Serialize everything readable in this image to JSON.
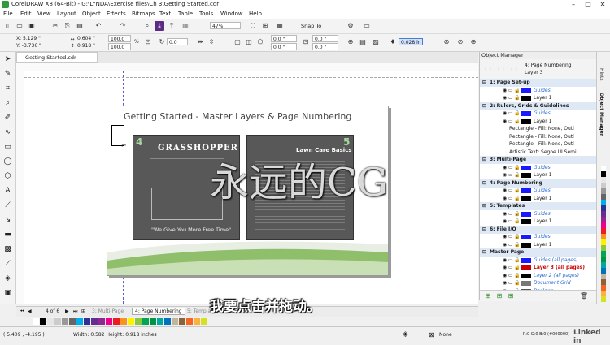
{
  "window": {
    "title": "CorelDRAW X8 (64-Bit) - G:\\LYNDA\\Exercise files\\Ch 3\\Getting Started.cdr"
  },
  "menu": [
    "File",
    "Edit",
    "View",
    "Layout",
    "Object",
    "Effects",
    "Bitmaps",
    "Text",
    "Table",
    "Tools",
    "Window",
    "Help"
  ],
  "toolbar": {
    "zoom": "47%",
    "snap_to": "Snap To"
  },
  "property_bar": {
    "x": "X: 5.129 \"",
    "y": "Y: -3.736 \"",
    "width": "0.604 \"",
    "height": "0.918 \"",
    "scale_w": "100.0",
    "scale_h": "100.0",
    "pct": "%",
    "angle": "0.0",
    "pos_x": "0.0 \"",
    "pos_y": "0.0 \"",
    "pos_x2": "0.0 \"",
    "pos_y2": "0.0 \"",
    "outline": "0.028 in"
  },
  "document": {
    "tab_label": "Getting Started.cdr",
    "page_title": "Getting Started - Master Layers & Page Numbering",
    "panel_left": {
      "number": "4",
      "heading": "GRASSHOPPER",
      "tagline": "\"We Give You More Free Time\""
    },
    "panel_right": {
      "number": "5",
      "heading": "Lawn Care Basics"
    }
  },
  "object_manager": {
    "title": "Object Manager",
    "current": "4: Page Numbering",
    "current_layer": "Layer 3",
    "rows": [
      {
        "label": "1: Page Set-up",
        "kind": "page"
      },
      {
        "label": "Guides",
        "kind": "guides",
        "swatch": "#1a1aff"
      },
      {
        "label": "Layer 1",
        "kind": "layer",
        "swatch": "#000000"
      },
      {
        "label": "2: Rulers, Grids & Guidelines",
        "kind": "page"
      },
      {
        "label": "Guides",
        "kind": "guides",
        "swatch": "#1a1aff"
      },
      {
        "label": "Layer 1",
        "kind": "layer",
        "swatch": "#000000"
      },
      {
        "label": "Rectangle - Fill: None, Outl",
        "kind": "object"
      },
      {
        "label": "Rectangle - Fill: None, Outl",
        "kind": "object"
      },
      {
        "label": "Rectangle - Fill: None, Outl",
        "kind": "object"
      },
      {
        "label": "Artistic Text: Segoe UI Semi",
        "kind": "object"
      },
      {
        "label": "3: Multi-Page",
        "kind": "page"
      },
      {
        "label": "Guides",
        "kind": "guides",
        "swatch": "#1a1aff"
      },
      {
        "label": "Layer 1",
        "kind": "layer",
        "swatch": "#000000"
      },
      {
        "label": "4: Page Numbering",
        "kind": "page"
      },
      {
        "label": "Guides",
        "kind": "guides",
        "swatch": "#1a1aff"
      },
      {
        "label": "Layer 1",
        "kind": "layer",
        "swatch": "#000000"
      },
      {
        "label": "5: Templates",
        "kind": "page"
      },
      {
        "label": "Guides",
        "kind": "guides",
        "swatch": "#1a1aff"
      },
      {
        "label": "Layer 1",
        "kind": "layer",
        "swatch": "#000000"
      },
      {
        "label": "6: File I/O",
        "kind": "page"
      },
      {
        "label": "Guides",
        "kind": "guides",
        "swatch": "#1a1aff"
      },
      {
        "label": "Layer 1",
        "kind": "layer",
        "swatch": "#000000"
      },
      {
        "label": "Master Page",
        "kind": "page"
      },
      {
        "label": "Guides (all pages)",
        "kind": "master-guides",
        "swatch": "#1a1aff"
      },
      {
        "label": "Layer 3 (all pages)",
        "kind": "master-active",
        "swatch": "#cc0000"
      },
      {
        "label": "Layer 2 (all pages)",
        "kind": "master-guides",
        "swatch": "#000000"
      },
      {
        "label": "Document Grid",
        "kind": "master-guides",
        "swatch": "#777777"
      },
      {
        "label": "Desktop",
        "kind": "master-guides",
        "swatch": "#555555"
      }
    ]
  },
  "side_tabs": [
    "Hints",
    "Object Manager"
  ],
  "page_nav": {
    "counter": "4 of 6",
    "tabs": [
      "3: Multi-Page",
      "4: Page Numbering",
      "5: Templates"
    ]
  },
  "status": {
    "coords": "( 5.409 , -4.195 )",
    "size": "Width: 0.582  Height: 0.918  inches",
    "fill": "None",
    "outline": "R:0 G:0 B:0 (#000000)"
  },
  "subtitle": "我要点击并拖动。",
  "watermark": "永远的CG",
  "brand": "Linked in",
  "palette": [
    "#ffffff",
    "#000000",
    "#e6e6e6",
    "#cccccc",
    "#999999",
    "#666666",
    "#00aeef",
    "#2e3192",
    "#662d91",
    "#92278f",
    "#ec008c",
    "#ed1c24",
    "#f7941d",
    "#fff200",
    "#8dc63f",
    "#00a651",
    "#009444",
    "#00a99d",
    "#0072bc",
    "#c2b59b",
    "#8c6239",
    "#f26522",
    "#fbb040",
    "#d7df23"
  ]
}
